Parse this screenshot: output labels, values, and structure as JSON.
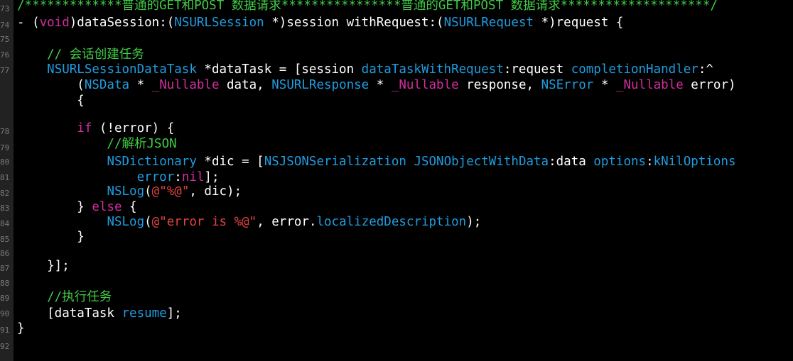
{
  "editor": {
    "line_numbers": [
      "73",
      "74",
      "75",
      "76",
      "77",
      "78",
      "79",
      "80",
      "81",
      "82",
      "83",
      "84",
      "85",
      "86",
      "87",
      "88",
      "89",
      "90",
      "91",
      "92"
    ],
    "lines": [
      [
        {
          "t": "/*************普通的GET和POST 数据请求****************普通的GET和POST 数据请求********************/",
          "c": "c"
        }
      ],
      [
        {
          "t": "- (",
          "c": "p"
        },
        {
          "t": "void",
          "c": "k"
        },
        {
          "t": ")dataSession:(",
          "c": "p"
        },
        {
          "t": "NSURLSession",
          "c": "t"
        },
        {
          "t": " *)session withRequest:(",
          "c": "p"
        },
        {
          "t": "NSURLRequest",
          "c": "t"
        },
        {
          "t": " *)request {",
          "c": "p"
        }
      ],
      [],
      [
        {
          "t": "    // 会话创建任务",
          "c": "c"
        }
      ],
      [
        {
          "t": "    ",
          "c": "p"
        },
        {
          "t": "NSURLSessionDataTask",
          "c": "t"
        },
        {
          "t": " *dataTask = [session ",
          "c": "p"
        },
        {
          "t": "dataTaskWithRequest",
          "c": "t"
        },
        {
          "t": ":request ",
          "c": "p"
        },
        {
          "t": "completionHandler",
          "c": "t"
        },
        {
          "t": ":^",
          "c": "p"
        }
      ],
      [
        {
          "t": "        (",
          "c": "p"
        },
        {
          "t": "NSData",
          "c": "t"
        },
        {
          "t": " * ",
          "c": "p"
        },
        {
          "t": "_Nullable",
          "c": "k"
        },
        {
          "t": " data, ",
          "c": "p"
        },
        {
          "t": "NSURLResponse",
          "c": "t"
        },
        {
          "t": " * ",
          "c": "p"
        },
        {
          "t": "_Nullable",
          "c": "k"
        },
        {
          "t": " response, ",
          "c": "p"
        },
        {
          "t": "NSError",
          "c": "t"
        },
        {
          "t": " * ",
          "c": "p"
        },
        {
          "t": "_Nullable",
          "c": "k"
        },
        {
          "t": " error)",
          "c": "p"
        }
      ],
      [
        {
          "t": "        {",
          "c": "p"
        }
      ],
      [],
      [
        {
          "t": "        ",
          "c": "p"
        },
        {
          "t": "if",
          "c": "k"
        },
        {
          "t": " (!error) {",
          "c": "p"
        }
      ],
      [
        {
          "t": "            //解析JSON",
          "c": "c"
        }
      ],
      [
        {
          "t": "            ",
          "c": "p"
        },
        {
          "t": "NSDictionary",
          "c": "t"
        },
        {
          "t": " *dic = [",
          "c": "p"
        },
        {
          "t": "NSJSONSerialization",
          "c": "t"
        },
        {
          "t": " ",
          "c": "p"
        },
        {
          "t": "JSONObjectWithData",
          "c": "t"
        },
        {
          "t": ":data ",
          "c": "p"
        },
        {
          "t": "options",
          "c": "t"
        },
        {
          "t": ":",
          "c": "p"
        },
        {
          "t": "kNilOptions",
          "c": "t"
        }
      ],
      [
        {
          "t": "                ",
          "c": "p"
        },
        {
          "t": "error",
          "c": "t"
        },
        {
          "t": ":",
          "c": "p"
        },
        {
          "t": "nil",
          "c": "k"
        },
        {
          "t": "];",
          "c": "p"
        }
      ],
      [
        {
          "t": "            ",
          "c": "p"
        },
        {
          "t": "NSLog",
          "c": "t"
        },
        {
          "t": "(",
          "c": "p"
        },
        {
          "t": "@\"%@\"",
          "c": "s"
        },
        {
          "t": ", dic);",
          "c": "p"
        }
      ],
      [
        {
          "t": "        } ",
          "c": "p"
        },
        {
          "t": "else",
          "c": "k"
        },
        {
          "t": " {",
          "c": "p"
        }
      ],
      [
        {
          "t": "            ",
          "c": "p"
        },
        {
          "t": "NSLog",
          "c": "t"
        },
        {
          "t": "(",
          "c": "p"
        },
        {
          "t": "@\"error is %@\"",
          "c": "s"
        },
        {
          "t": ", error.",
          "c": "p"
        },
        {
          "t": "localizedDescription",
          "c": "t"
        },
        {
          "t": ");",
          "c": "p"
        }
      ],
      [
        {
          "t": "        }",
          "c": "p"
        }
      ],
      [],
      [
        {
          "t": "    }];",
          "c": "p"
        }
      ],
      [],
      [
        {
          "t": "    //执行任务",
          "c": "c"
        }
      ],
      [
        {
          "t": "    [dataTask ",
          "c": "p"
        },
        {
          "t": "resume",
          "c": "t"
        },
        {
          "t": "];",
          "c": "p"
        }
      ],
      [
        {
          "t": "}",
          "c": "p"
        }
      ],
      []
    ]
  }
}
